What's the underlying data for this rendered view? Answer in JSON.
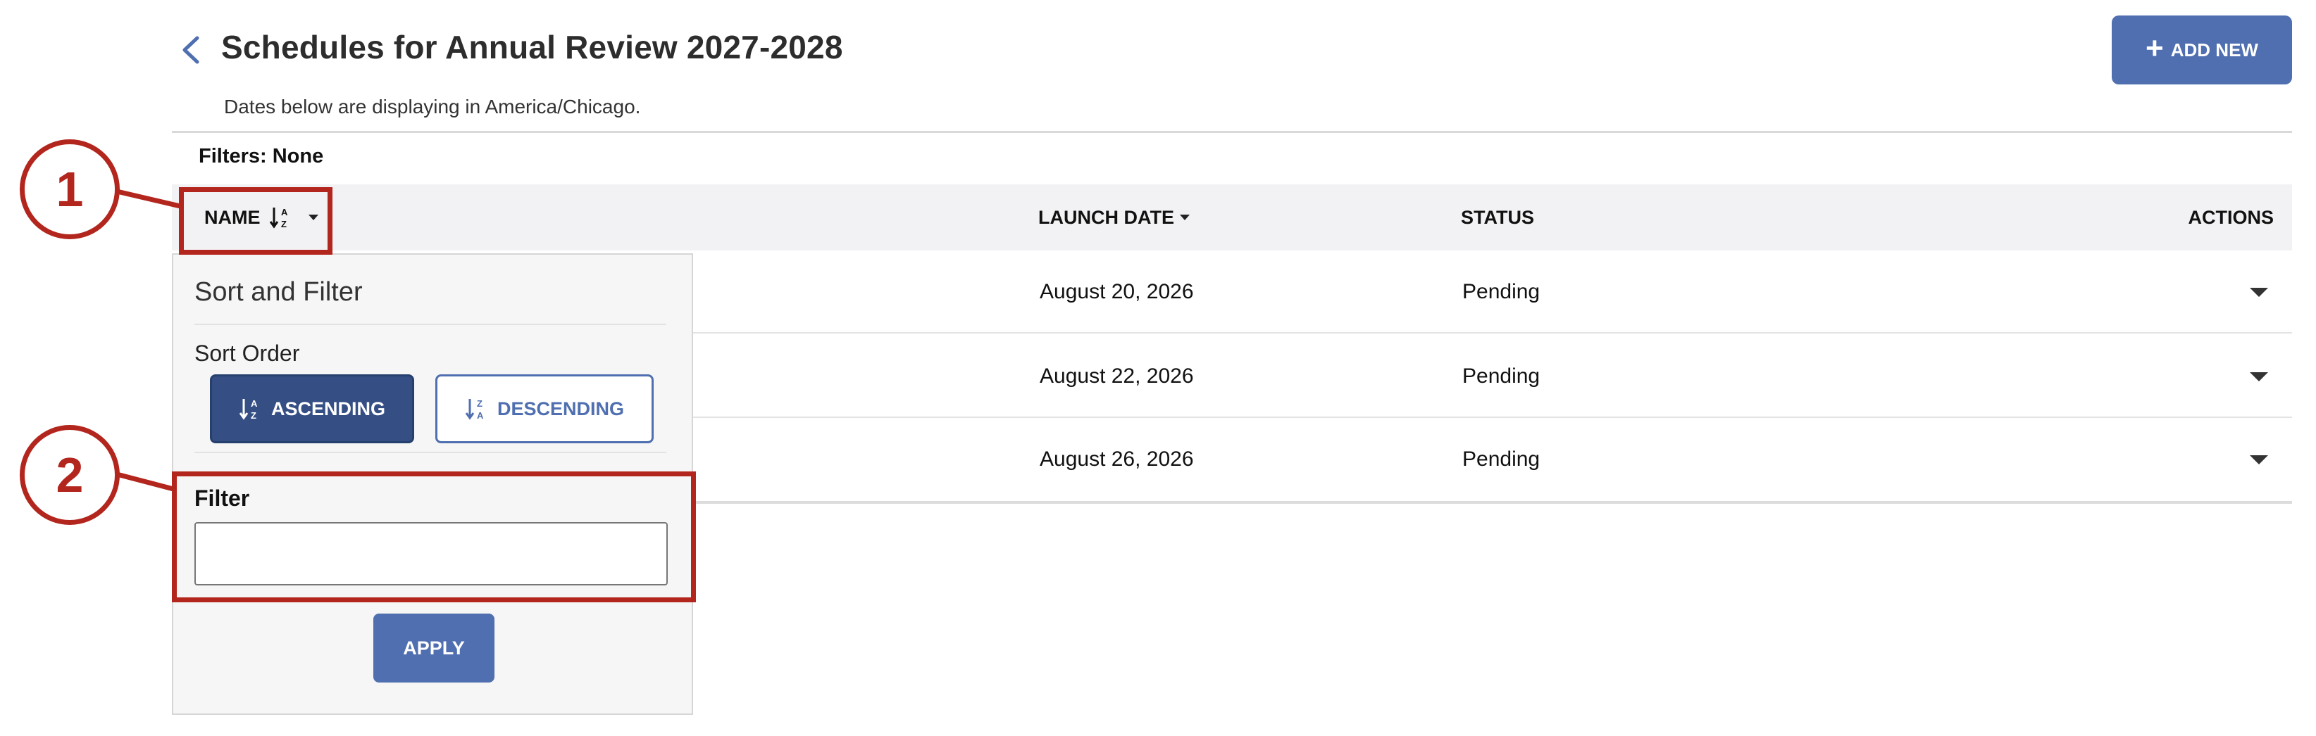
{
  "header": {
    "title": "Schedules for Annual Review 2027-2028",
    "subtitle": "Dates below are displaying in America/Chicago.",
    "add_new_label": "ADD NEW",
    "back_icon": "chevron-left-icon"
  },
  "filters_text": "Filters: None",
  "table": {
    "columns": {
      "name": "NAME",
      "launch_date": "LAUNCH DATE",
      "status": "STATUS",
      "actions": "ACTIONS"
    },
    "rows": [
      {
        "launch_date": "August 20, 2026",
        "status": "Pending"
      },
      {
        "launch_date": "August 22, 2026",
        "status": "Pending"
      },
      {
        "launch_date": "August 26, 2026",
        "status": "Pending"
      }
    ]
  },
  "sort_filter_panel": {
    "title": "Sort and Filter",
    "sort_order_label": "Sort Order",
    "ascending_label": "ASCENDING",
    "descending_label": "DESCENDING",
    "filter_label": "Filter",
    "filter_value": "",
    "filter_placeholder": "",
    "apply_label": "APPLY"
  },
  "annotations": [
    {
      "number": "1"
    },
    {
      "number": "2"
    }
  ],
  "colors": {
    "primary": "#4f6fb0",
    "primary_dark": "#354f84",
    "annotation_red": "#b3261e",
    "header_bg": "#f2f2f4"
  }
}
